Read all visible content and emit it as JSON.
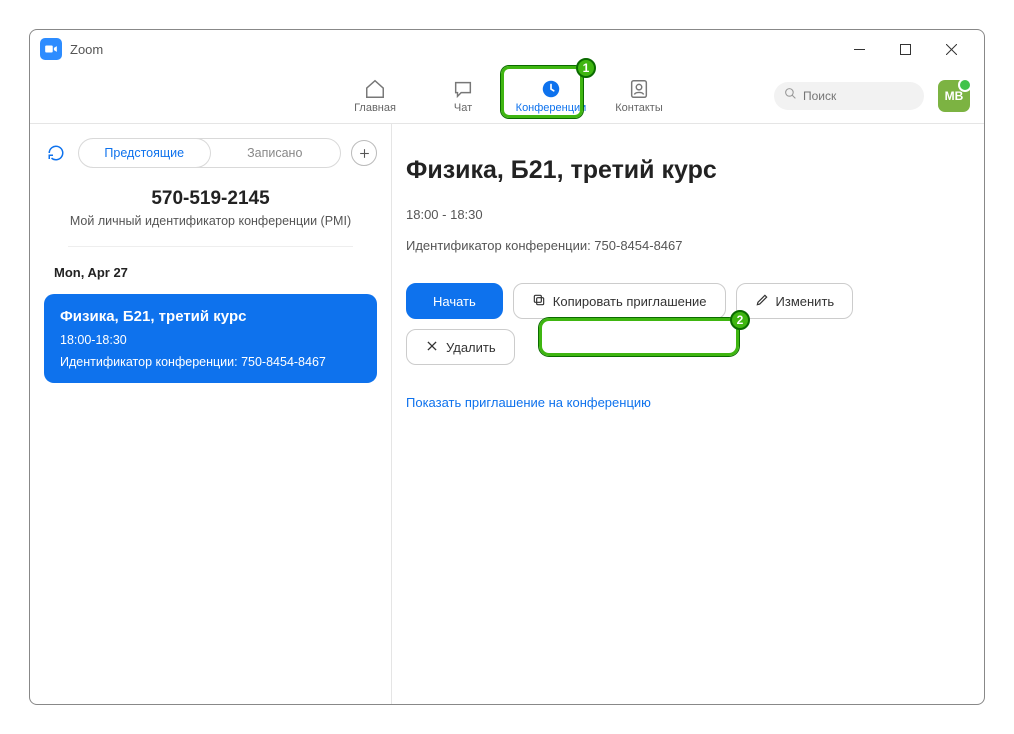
{
  "app": {
    "title": "Zoom"
  },
  "nav": {
    "items": [
      {
        "label": "Главная"
      },
      {
        "label": "Чат"
      },
      {
        "label": "Конференции"
      },
      {
        "label": "Контакты"
      }
    ],
    "search_placeholder": "Поиск",
    "avatar_initials": "МВ"
  },
  "sidebar": {
    "tabs": {
      "upcoming": "Предстоящие",
      "recorded": "Записано"
    },
    "pmi": {
      "number": "570-519-2145",
      "label": "Мой личный идентификатор конференции (PMI)"
    },
    "date_header": "Mon, Apr 27",
    "card": {
      "title": "Физика, Б21, третий курс",
      "time": "18:00-18:30",
      "id_line": "Идентификатор конференции: 750-8454-8467"
    }
  },
  "main": {
    "title": "Физика, Б21, третий курс",
    "time": "18:00 - 18:30",
    "id_line": "Идентификатор конференции: 750-8454-8467",
    "buttons": {
      "start": "Начать",
      "copy": "Копировать приглашение",
      "edit": "Изменить",
      "delete": "Удалить"
    },
    "show_invite_link": "Показать приглашение на конференцию"
  },
  "annotations": {
    "one": "1",
    "two": "2"
  }
}
